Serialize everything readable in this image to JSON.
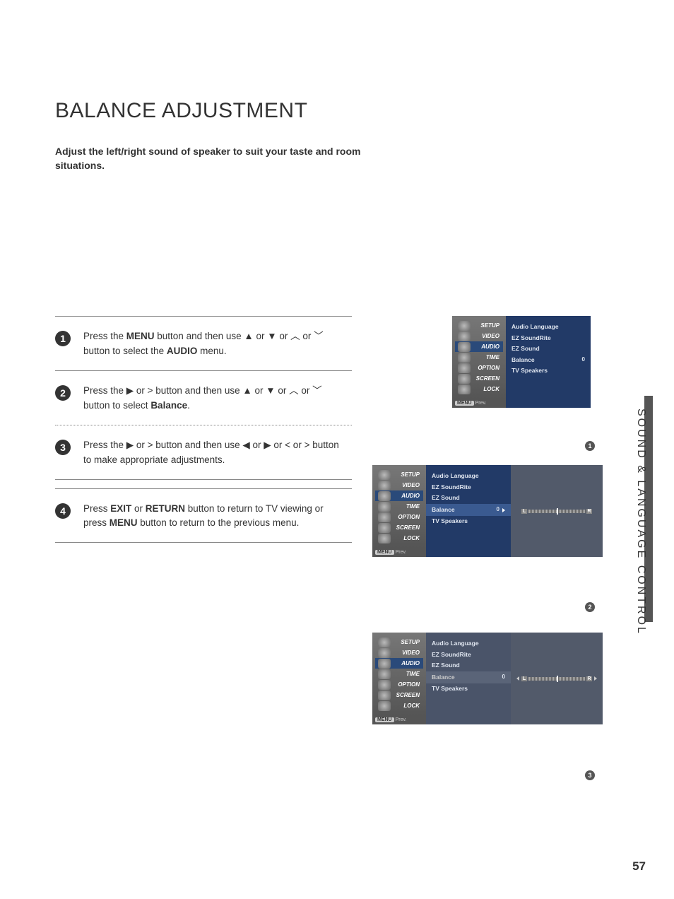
{
  "title": "BALANCE ADJUSTMENT",
  "intro": "Adjust the left/right sound of speaker to suit your taste and room situations.",
  "side_label": "SOUND & LANGUAGE CONTROL",
  "page_number": "57",
  "steps": [
    {
      "n": "1",
      "text_a": "Press the ",
      "b1": "MENU",
      "text_b": " button and then use ▲ or ▼  or  ︿ or ﹀  button to select the ",
      "b2": "AUDIO",
      "text_c": " menu."
    },
    {
      "n": "2",
      "text_a": "Press the ▶  or  >  button and then use ▲ or ▼ or ︿ or ﹀  button to select ",
      "b1": "Balance",
      "text_b": "."
    },
    {
      "n": "3",
      "text_a": "Press the ▶  or  >  button and then use ◀ or ▶ or <  or  >  button to make appropriate adjustments."
    },
    {
      "n": "4",
      "text_a": "Press ",
      "b1": "EXIT",
      "text_b": " or ",
      "b2": "RETURN",
      "text_c": " button to return to TV viewing or press ",
      "b3": "MENU",
      "text_d": " button to return to the previous menu."
    }
  ],
  "menu_items": [
    "SETUP",
    "VIDEO",
    "AUDIO",
    "TIME",
    "OPTION",
    "SCREEN",
    "LOCK"
  ],
  "panel_items": [
    {
      "label": "Audio Language",
      "val": ""
    },
    {
      "label": "EZ SoundRite",
      "val": ""
    },
    {
      "label": "EZ Sound",
      "val": ""
    },
    {
      "label": "Balance",
      "val": "0"
    },
    {
      "label": "TV Speakers",
      "val": ""
    }
  ],
  "prev_label": "Prev.",
  "slider_L": "L",
  "slider_R": "R",
  "captions": {
    "c1": "1",
    "c2": "2",
    "c3": "3"
  }
}
